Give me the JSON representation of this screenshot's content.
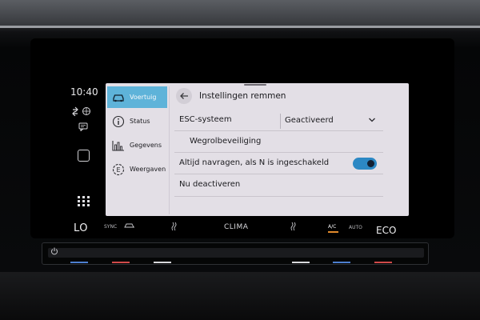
{
  "status": {
    "time": "10:40",
    "left_label": "LO",
    "sync_label": "SYNC",
    "clima_label": "CLIMA",
    "ac_label": "A/C",
    "auto_label": "AUTO",
    "eco_label": "ECO"
  },
  "menu": {
    "items": [
      {
        "label": "Voertuig",
        "icon": "car-icon",
        "active": true
      },
      {
        "label": "Status",
        "icon": "info-icon",
        "active": false
      },
      {
        "label": "Gegevens",
        "icon": "bar-chart-icon",
        "active": false
      },
      {
        "label": "Weergaven",
        "icon": "eco-display-icon",
        "active": false
      }
    ]
  },
  "header": {
    "title": "Instellingen remmen"
  },
  "settings": {
    "esc_label": "ESC-systeem",
    "esc_value": "Geactiveerd",
    "hill_hold_label": "Wegrolbeveiliging",
    "ask_label": "Altijd navragen, als N is ingeschakeld",
    "ask_enabled": true,
    "deactivate_label": "Nu deactiveren"
  },
  "colors": {
    "accent": "#5eb3d9",
    "toggle_on": "#2c88c4",
    "panel_bg": "#e3dfe6",
    "ac_indicator": "#e08a2c"
  }
}
